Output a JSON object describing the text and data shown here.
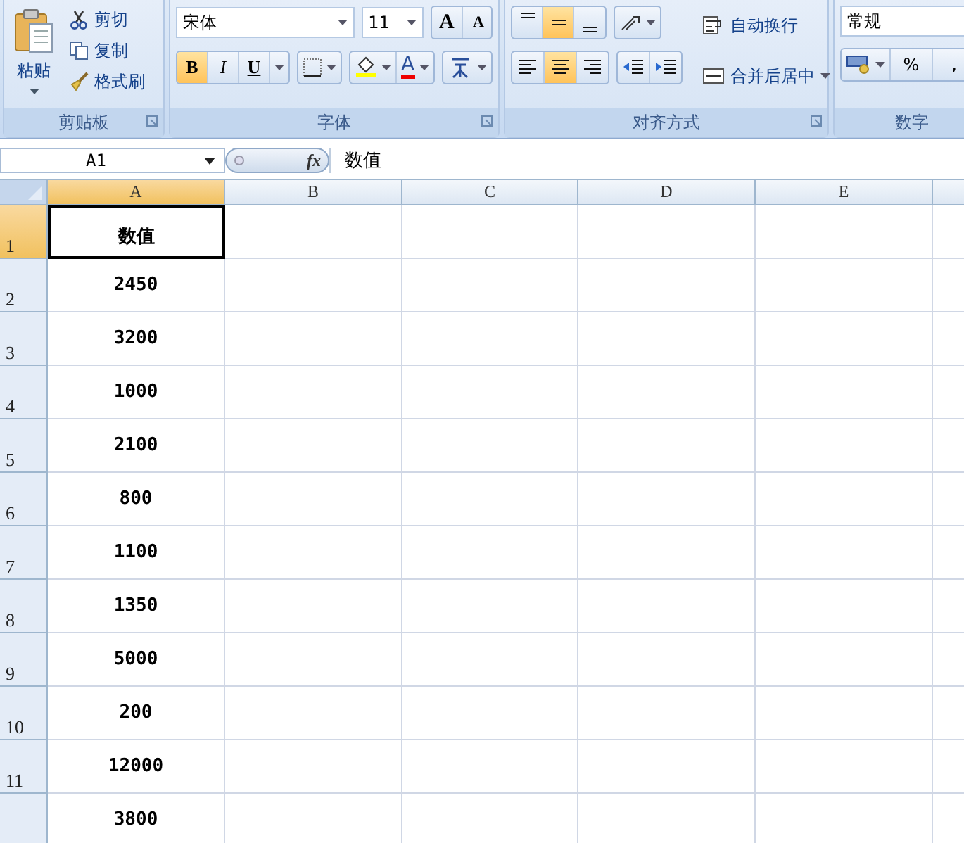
{
  "ribbon": {
    "clipboard": {
      "paste": "粘贴",
      "cut": "剪切",
      "copy": "复制",
      "format_painter": "格式刷",
      "label": "剪贴板"
    },
    "font": {
      "font_name": "宋体",
      "font_size": "11",
      "grow": "A",
      "shrink": "A",
      "font_color": "A",
      "label": "字体",
      "styles": [
        {
          "label": "B",
          "kind": "bold",
          "selected": true
        },
        {
          "label": "I",
          "kind": "italic",
          "selected": false
        },
        {
          "label": "U",
          "kind": "underline",
          "selected": false
        }
      ]
    },
    "alignment": {
      "vertical": [
        {
          "kind": "top",
          "selected": false
        },
        {
          "kind": "middle",
          "selected": true
        },
        {
          "kind": "bottom",
          "selected": false
        }
      ],
      "horizontal": [
        {
          "kind": "left",
          "selected": false
        },
        {
          "kind": "center",
          "selected": true
        },
        {
          "kind": "right",
          "selected": false
        }
      ],
      "wrap_text": "自动换行",
      "merge_center": "合并后居中",
      "label": "对齐方式"
    },
    "number": {
      "format": "常规",
      "percent": "%",
      "comma": ",",
      "label": "数字"
    }
  },
  "formula_bar": {
    "name_box": "A1",
    "fx": "fx",
    "formula": "数值"
  },
  "columns": [
    {
      "label": "A",
      "selected": true
    },
    {
      "label": "B",
      "selected": false
    },
    {
      "label": "C",
      "selected": false
    },
    {
      "label": "D",
      "selected": false
    },
    {
      "label": "E",
      "selected": false
    }
  ],
  "rows": [
    {
      "number": "1",
      "selected": true,
      "value": "数值"
    },
    {
      "number": "2",
      "selected": false,
      "value": "2450"
    },
    {
      "number": "3",
      "selected": false,
      "value": "3200"
    },
    {
      "number": "4",
      "selected": false,
      "value": "1000"
    },
    {
      "number": "5",
      "selected": false,
      "value": "2100"
    },
    {
      "number": "6",
      "selected": false,
      "value": "800"
    },
    {
      "number": "7",
      "selected": false,
      "value": "1100"
    },
    {
      "number": "8",
      "selected": false,
      "value": "1350"
    },
    {
      "number": "9",
      "selected": false,
      "value": "5000"
    },
    {
      "number": "10",
      "selected": false,
      "value": "200"
    },
    {
      "number": "11",
      "selected": false,
      "value": "12000"
    },
    {
      "selected": false,
      "value": "3800"
    }
  ]
}
